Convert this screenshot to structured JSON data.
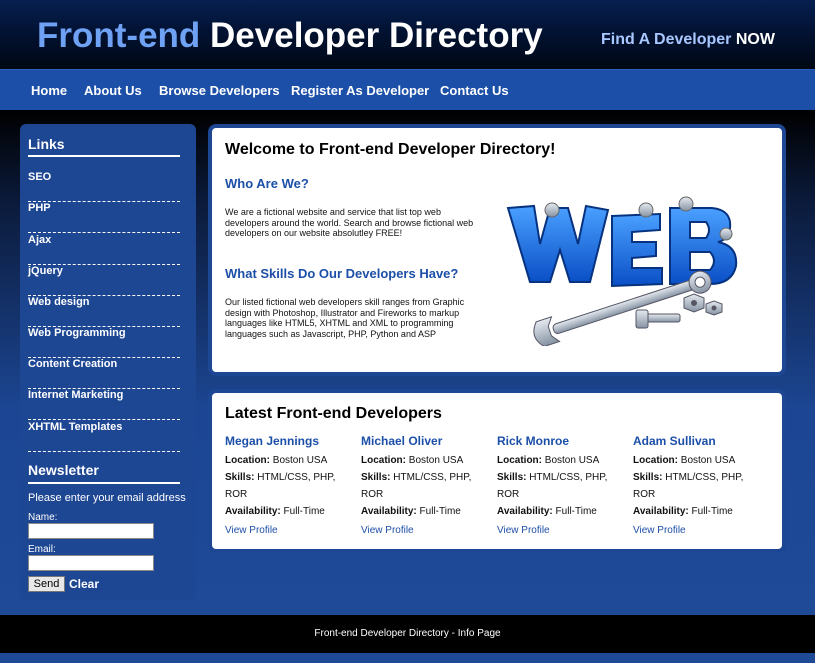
{
  "header": {
    "logo_part1": "Front-end",
    "logo_part2": "Developer Directory",
    "cta_part1": "Find A Developer",
    "cta_part2": "NOW"
  },
  "nav": [
    "Home",
    "About Us",
    "Browse Developers",
    "Register As Developer",
    "Contact Us"
  ],
  "sidebar": {
    "links_title": "Links",
    "links": [
      "SEO",
      "PHP",
      "Ajax",
      "jQuery",
      "Web design",
      "Web Programming",
      "Content Creation",
      "Internet Marketing",
      "XHTML Templates"
    ],
    "newsletter_title": "Newsletter",
    "newsletter_prompt": "Please enter your email address",
    "name_label": "Name:",
    "email_label": "Email:",
    "send_label": "Send",
    "clear_label": "Clear"
  },
  "welcome": {
    "title": "Welcome to Front-end Developer Directory!",
    "who_heading": "Who Are We?",
    "who_text": "We are a fictional website and service that list top web developers around the world. Search and browse fictional web developers on our website absolutley FREE!",
    "skills_heading": "What Skills Do Our Developers Have?",
    "skills_text": "Our listed fictional web developers skill ranges from Graphic design with Photoshop, Illustrator and Fireworks to markup languages like HTML5, XHTML and XML to programming languages such as Javascript, PHP, Python and ASP",
    "image_text": "WEB"
  },
  "latest": {
    "title": "Latest Front-end Developers",
    "labels": {
      "location": "Location:",
      "skills": "Skills:",
      "availability": "Availability:"
    },
    "developers": [
      {
        "name": "Megan Jennings",
        "location": "Boston USA",
        "skills": "HTML/CSS, PHP, ROR",
        "availability": "Full-Time",
        "link": "View Profile"
      },
      {
        "name": "Michael Oliver",
        "location": "Boston USA",
        "skills": "HTML/CSS, PHP, ROR",
        "availability": "Full-Time",
        "link": "View Profile"
      },
      {
        "name": "Rick Monroe",
        "location": "Boston USA",
        "skills": "HTML/CSS, PHP, ROR",
        "availability": "Full-Time",
        "link": "View Profile"
      },
      {
        "name": "Adam Sullivan",
        "location": "Boston USA",
        "skills": "HTML/CSS, PHP, ROR",
        "availability": "Full-Time",
        "link": "View Profile"
      }
    ]
  },
  "footer": {
    "text": "Front-end Developer Directory - Info Page"
  },
  "colors": {
    "brand_blue": "#1c4fa8",
    "logo_light": "#6fa2f4",
    "panel_border": "#1d4693"
  }
}
